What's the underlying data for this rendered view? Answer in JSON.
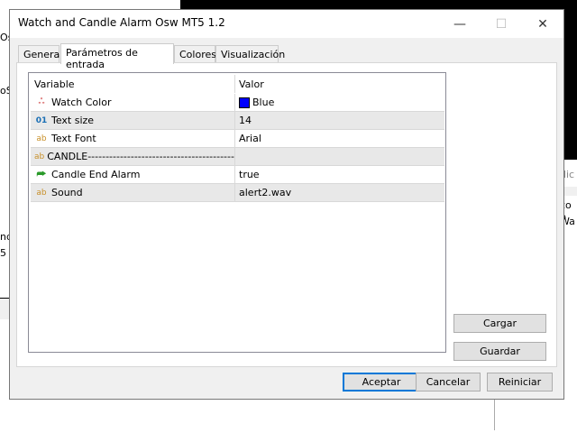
{
  "window": {
    "title": "Watch and Candle Alarm Osw MT5 1.2",
    "minimize": "—",
    "maximize": "☐",
    "close": "✕"
  },
  "tabs": [
    {
      "label": "General"
    },
    {
      "label": "Parámetros de entrada"
    },
    {
      "label": "Colores"
    },
    {
      "label": "Visualización"
    }
  ],
  "table": {
    "headers": {
      "variable": "Variable",
      "value": "Valor"
    },
    "rows": [
      {
        "icon": "color-icon",
        "glyph": "ஃ",
        "variable": "Watch Color",
        "value": "Blue",
        "swatch": "#0000ff"
      },
      {
        "icon": "integer-icon",
        "glyph": "01",
        "variable": "Text size",
        "value": "14"
      },
      {
        "icon": "string-icon",
        "glyph": "ab",
        "variable": "Text Font",
        "value": "Arial"
      },
      {
        "icon": "string-icon",
        "glyph": "ab",
        "variable": "CANDLE-------------------------------------------...",
        "value": ""
      },
      {
        "icon": "bool-icon",
        "glyph": "⮫",
        "variable": "Candle End Alarm",
        "value": "true"
      },
      {
        "icon": "string-icon",
        "glyph": "ab",
        "variable": "Sound",
        "value": "alert2.wav"
      }
    ]
  },
  "side_buttons": {
    "load": "Cargar",
    "save": "Guardar"
  },
  "footer": {
    "ok": "Aceptar",
    "cancel": "Cancelar",
    "reset": "Reiniciar"
  },
  "background": {
    "frag1": "Os",
    "frag2": "oS",
    "frag3": "nd",
    "frag4": "5",
    "frag5": "dic",
    "frag6": "co p",
    "frag7": "Wa"
  }
}
